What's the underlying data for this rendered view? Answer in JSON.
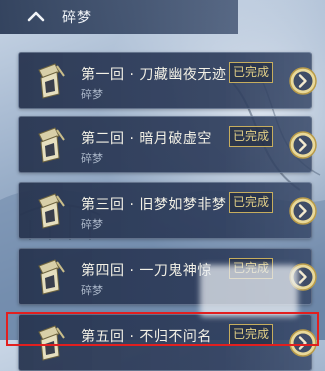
{
  "header": {
    "title": "碎梦"
  },
  "chapters": [
    {
      "name": "第一回 · 刀藏幽夜无迹",
      "subtitle": "碎梦",
      "status": "已完成"
    },
    {
      "name": "第二回 · 暗月破虚空",
      "subtitle": "碎梦",
      "status": "已完成"
    },
    {
      "name": "第三回 · 旧梦如梦非梦",
      "subtitle": "碎梦",
      "status": "已完成"
    },
    {
      "name": "第四回 · 一刀鬼神惊",
      "subtitle": "碎梦",
      "status": "已完成"
    },
    {
      "name": "第五回 · 不归不问名",
      "subtitle": "",
      "status": "已完成"
    }
  ],
  "colors": {
    "accent_gold": "#c6ad5e",
    "highlight_red": "#e21f1f",
    "card_bg": "#2e3d5c"
  }
}
